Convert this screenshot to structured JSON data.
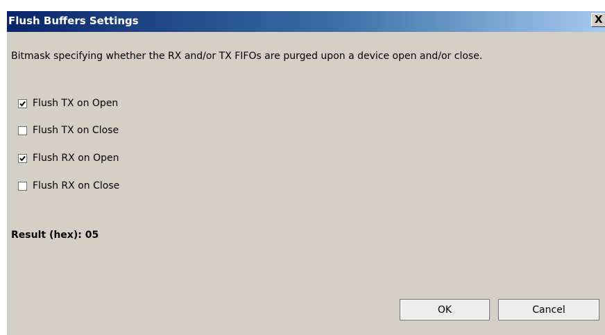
{
  "window": {
    "title": "Flush Buffers Settings",
    "close_label": "X"
  },
  "description": "Bitmask specifying whether the RX and/or TX FIFOs are purged upon a device open and/or close.",
  "options": [
    {
      "label": "Flush TX on Open",
      "checked": true
    },
    {
      "label": "Flush TX on Close",
      "checked": false
    },
    {
      "label": "Flush RX on Open",
      "checked": true
    },
    {
      "label": "Flush RX on Close",
      "checked": false
    }
  ],
  "result": {
    "text": "Result (hex): 05"
  },
  "buttons": {
    "ok_label": "OK",
    "cancel_label": "Cancel"
  },
  "colors": {
    "titlebar_start": "#0a246a",
    "titlebar_end": "#a6caf0",
    "dialog_background": "#d4d0c8"
  }
}
